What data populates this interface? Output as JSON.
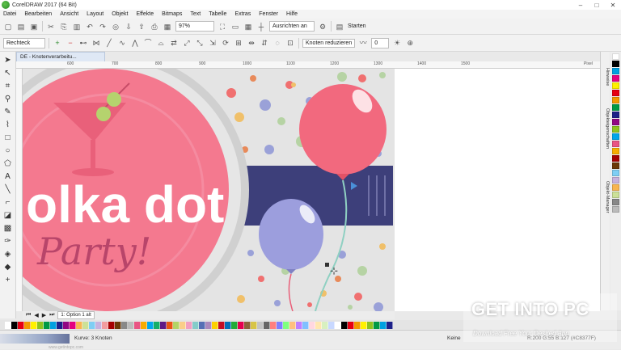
{
  "window": {
    "title": "CorelDRAW 2017 (64 Bit)",
    "minimize": "–",
    "maximize": "□",
    "close": "✕"
  },
  "menu": [
    "Datei",
    "Bearbeiten",
    "Ansicht",
    "Layout",
    "Objekt",
    "Effekte",
    "Bitmaps",
    "Text",
    "Tabelle",
    "Extras",
    "Fenster",
    "Hilfe"
  ],
  "toolbar1": {
    "zoom": "97%",
    "snap": "Ausrichten an",
    "launch": "Starten"
  },
  "toolbar2": {
    "shape": "Rechteck",
    "reduce_nodes": "Knoten reduzieren",
    "smoothness": "0"
  },
  "document": {
    "tab": "DE - Knotenverarbeitu...",
    "page_tab": "1: Option 1 alt"
  },
  "rulers": {
    "h": [
      "600",
      "700",
      "800",
      "900",
      "1000",
      "1100",
      "1200",
      "1300",
      "1400",
      "1500",
      "Pixel"
    ]
  },
  "artwork": {
    "line1": "olka dot",
    "line2": "Party!"
  },
  "dockers": [
    "Hinweise",
    "Objekteigenschaften",
    "Objekt-Manager"
  ],
  "status": {
    "curve": "Kurve: 3 Knoten",
    "fill_none": "Keine",
    "outline": "R:200 G:55 B:127 (#C8377F)"
  },
  "watermark": {
    "text": "GET INTO PC",
    "sub": "Download Free Your Desired App",
    "ad": "www.getintopc.com"
  },
  "colors": {
    "accent": "#C8377F",
    "pink": "#F4798F",
    "navy": "#3D3F7A",
    "balloon_red": "#F2697E",
    "balloon_purple": "#9C9EDD"
  }
}
